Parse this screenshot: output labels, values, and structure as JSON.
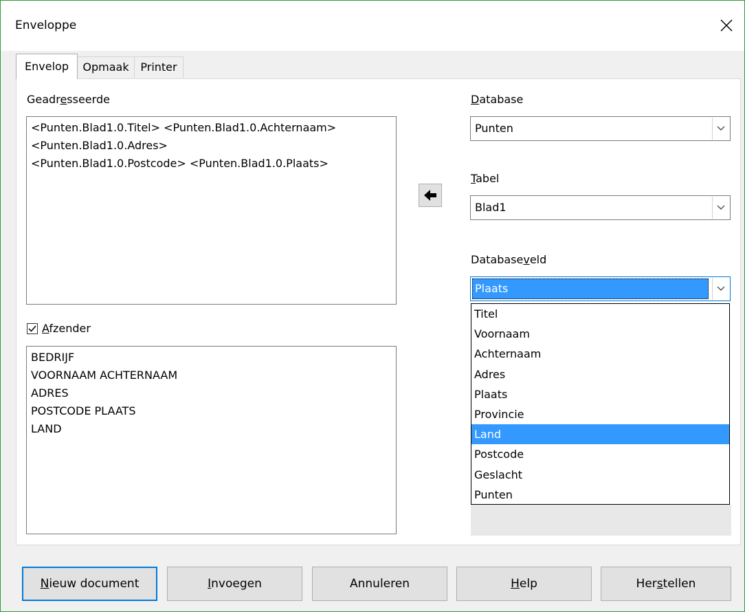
{
  "window": {
    "title": "Enveloppe"
  },
  "tabs": [
    {
      "label": "Envelop",
      "active": true
    },
    {
      "label": "Opmaak",
      "active": false
    },
    {
      "label": "Printer",
      "active": false
    }
  ],
  "addressee": {
    "label_pre": "Geadr",
    "label_mnemonic": "e",
    "label_post": "sseerde",
    "lines": [
      "<Punten.Blad1.0.Titel> <Punten.Blad1.0.Achternaam>",
      "<Punten.Blad1.0.Adres>",
      "<Punten.Blad1.0.Postcode> <Punten.Blad1.0.Plaats>"
    ]
  },
  "sender": {
    "checked": true,
    "label_mnemonic": "A",
    "label_post": "fzender",
    "lines": [
      "BEDRIJF",
      "VOORNAAM ACHTERNAAM",
      "ADRES",
      "POSTCODE PLAATS",
      "LAND"
    ]
  },
  "database": {
    "label_mnemonic": "D",
    "label_post": "atabase",
    "value": "Punten"
  },
  "table": {
    "label_mnemonic": "T",
    "label_post": "abel",
    "value": "Blad1"
  },
  "field": {
    "label_pre": "Database",
    "label_mnemonic": "v",
    "label_post": "eld",
    "value": "Plaats",
    "options": [
      "Titel",
      "Voornaam",
      "Achternaam",
      "Adres",
      "Plaats",
      "Provincie",
      "Land",
      "Postcode",
      "Geslacht",
      "Punten"
    ],
    "highlighted": "Land"
  },
  "buttons": {
    "new_doc": {
      "mnemonic": "N",
      "post": "ieuw document"
    },
    "insert": {
      "mnemonic": "I",
      "post": "nvoegen"
    },
    "cancel": {
      "label": "Annuleren"
    },
    "help": {
      "mnemonic": "H",
      "post": "elp"
    },
    "reset": {
      "pre": "Her",
      "mnemonic": "s",
      "post": "tellen"
    }
  },
  "icons": {
    "insert_arrow": "arrow-left-icon",
    "close": "close-icon",
    "dropdown": "chevron-down-icon",
    "check": "check-icon"
  },
  "colors": {
    "accent": "#0078d7",
    "selection": "#3399ff",
    "window_border": "#2e9a3a"
  }
}
